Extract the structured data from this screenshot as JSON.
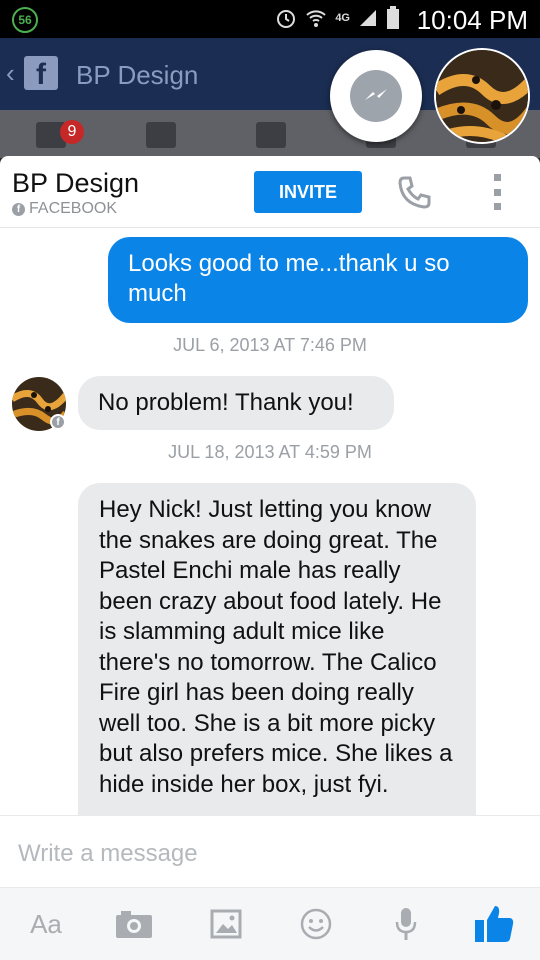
{
  "status_bar": {
    "notification_count": "56",
    "network": "4G",
    "time": "10:04 PM"
  },
  "background_app": {
    "title": "BP Design",
    "notification_badge": "9"
  },
  "chat": {
    "contact_name": "BP Design",
    "contact_source": "FACEBOOK",
    "invite_label": "INVITE",
    "messages": [
      {
        "direction": "outgoing",
        "text": "Looks good to me...thank u so much"
      },
      {
        "type": "timestamp",
        "text": "JUL 6, 2013 AT 7:46 PM"
      },
      {
        "direction": "incoming",
        "text": "No problem! Thank you!"
      },
      {
        "type": "timestamp",
        "text": "JUL 18, 2013 AT 4:59 PM"
      },
      {
        "direction": "incoming",
        "text": "Hey Nick! Just letting you know the snakes are doing great. The Pastel Enchi male has really been crazy about food lately. He is slamming adult mice like there's no tomorrow. The Calico Fire girl has been doing really well too. She is a bit more picky but also prefers mice. She likes a hide inside her box, just fyi."
      }
    ]
  },
  "composer": {
    "placeholder": "Write a message",
    "text_format_label": "Aa"
  },
  "colors": {
    "accent": "#0a84e6",
    "incoming_bubble": "#e9eaeb",
    "timestamp": "#9aa0a6"
  }
}
